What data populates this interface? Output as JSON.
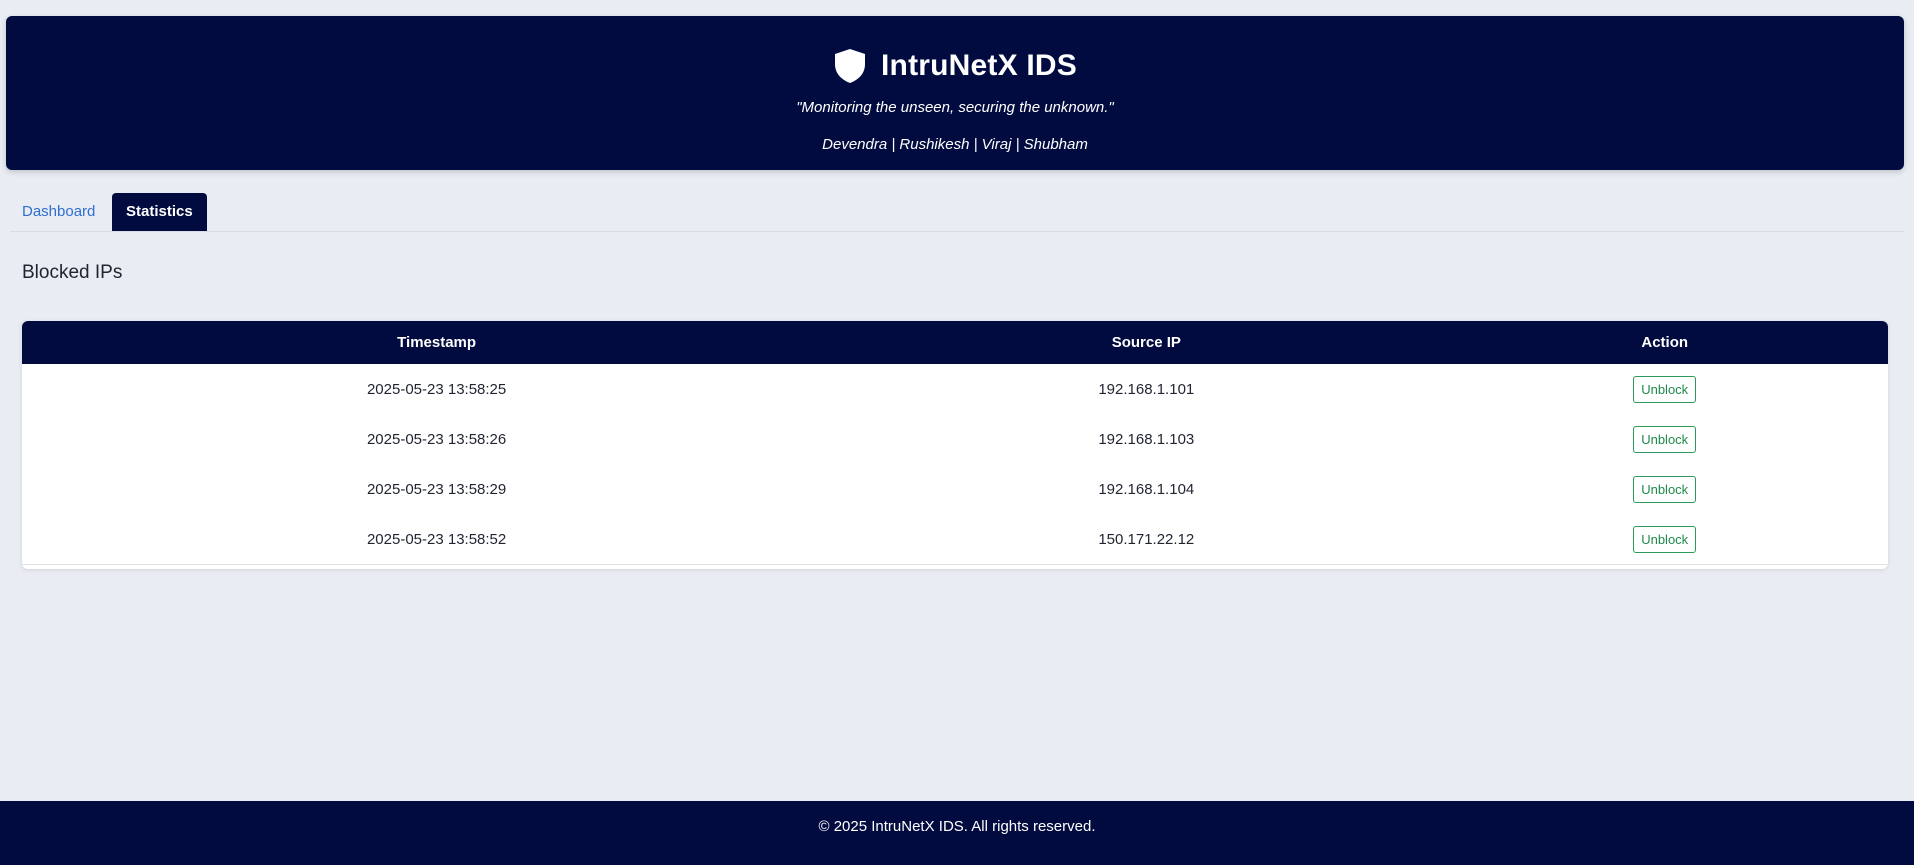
{
  "header": {
    "icon": "shield-icon",
    "title": "IntruNetX IDS",
    "tagline": "\"Monitoring the unseen, securing the unknown.\"",
    "team": "Devendra | Rushikesh | Viraj | Shubham"
  },
  "tabs": [
    {
      "label": "Dashboard",
      "active": false
    },
    {
      "label": "Statistics",
      "active": true
    }
  ],
  "section": {
    "title": "Blocked IPs"
  },
  "table": {
    "headers": [
      "Timestamp",
      "Source IP",
      "Action"
    ],
    "rows": [
      {
        "timestamp": "2025-05-23 13:58:25",
        "source_ip": "192.168.1.101",
        "action": "Unblock"
      },
      {
        "timestamp": "2025-05-23 13:58:26",
        "source_ip": "192.168.1.103",
        "action": "Unblock"
      },
      {
        "timestamp": "2025-05-23 13:58:29",
        "source_ip": "192.168.1.104",
        "action": "Unblock"
      },
      {
        "timestamp": "2025-05-23 13:58:52",
        "source_ip": "150.171.22.12",
        "action": "Unblock"
      }
    ]
  },
  "footer": {
    "text": "© 2025 IntruNetX IDS. All rights reserved."
  },
  "colors": {
    "navy": "#020b3f",
    "background": "#e9ecf2",
    "link_blue": "#2e6fd1",
    "unblock_green": "#1f8a4c"
  }
}
